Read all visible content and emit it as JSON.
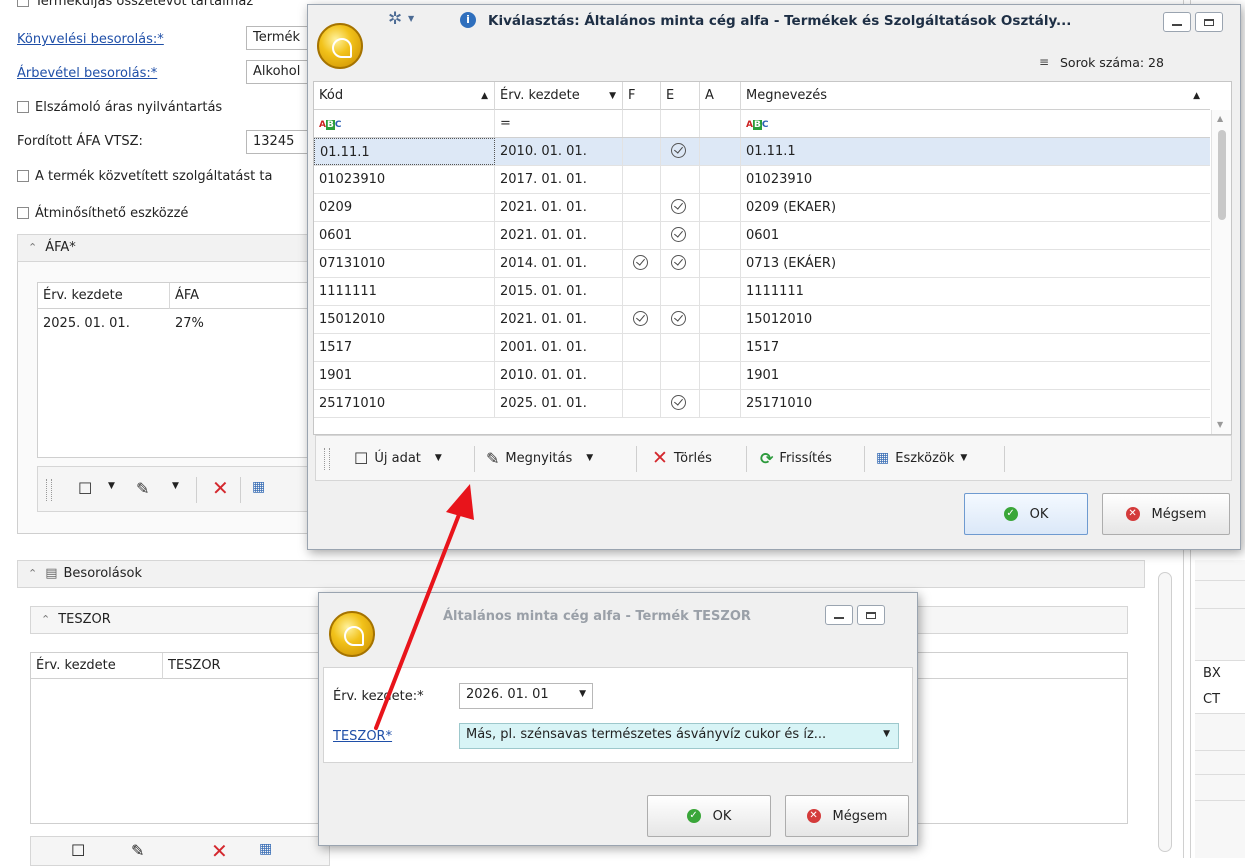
{
  "bg_form": {
    "top_checkbox": "Termékdíjas összetevőt tartalmaz",
    "konyv_label": "Könyvelési besorolás:*",
    "konyv_value": "Termék",
    "arbevetel_label": "Árbevétel besorolás:*",
    "arbevetel_value": "Alkohol",
    "elszamolo": "Elszámoló áras nyilvántartás",
    "forditott_label": "Fordított ÁFA VTSZ:",
    "forditott_value": "13245",
    "kozvetitett": "A termék közvetített szolgáltatást ta",
    "atminosit": "Átminősíthető eszközzé",
    "afa_group": "ÁFA*",
    "afa_cols": [
      "Érv. kezdete",
      "ÁFA"
    ],
    "afa_row": [
      "2025. 01. 01.",
      "27%"
    ],
    "besorolasok": "Besorolások",
    "teszor_group": "TESZOR",
    "teszor_cols": [
      "Érv. kezdete",
      "TESZOR"
    ],
    "right_cells": [
      "BX",
      "CT"
    ]
  },
  "kivalasztas": {
    "title": "Kiválasztás: Általános minta cég alfa - Termékek és Szolgáltatások Osztály...",
    "row_count": "Sorok száma: 28",
    "columns": [
      "Kód",
      "Érv. kezdete",
      "F",
      "E",
      "A",
      "Megnevezés"
    ],
    "filter_eq": "=",
    "rows": [
      {
        "kod": "01.11.1",
        "erv": "2010. 01. 01.",
        "f": false,
        "e": true,
        "nev": "01.11.1"
      },
      {
        "kod": "01023910",
        "erv": "2017. 01. 01.",
        "f": false,
        "e": false,
        "nev": "01023910"
      },
      {
        "kod": "0209",
        "erv": "2021. 01. 01.",
        "f": false,
        "e": true,
        "nev": "0209 (EKAER)"
      },
      {
        "kod": "0601",
        "erv": "2021. 01. 01.",
        "f": false,
        "e": true,
        "nev": "0601"
      },
      {
        "kod": "07131010",
        "erv": "2014. 01. 01.",
        "f": true,
        "e": true,
        "nev": "0713 (EKÁER)"
      },
      {
        "kod": "1111111",
        "erv": "2015. 01. 01.",
        "f": false,
        "e": false,
        "nev": "1111111"
      },
      {
        "kod": "15012010",
        "erv": "2021. 01. 01.",
        "f": true,
        "e": true,
        "nev": "15012010"
      },
      {
        "kod": "1517",
        "erv": "2001. 01. 01.",
        "f": false,
        "e": false,
        "nev": "1517"
      },
      {
        "kod": "1901",
        "erv": "2010. 01. 01.",
        "f": false,
        "e": false,
        "nev": "1901"
      },
      {
        "kod": "25171010",
        "erv": "2025. 01. 01.",
        "f": false,
        "e": true,
        "nev": "25171010"
      }
    ],
    "toolbar": {
      "uj": "Új adat",
      "megnyitas": "Megnyitás",
      "torles": "Törlés",
      "frissites": "Frissítés",
      "eszkozok": "Eszközök"
    },
    "ok": "OK",
    "cancel": "Mégsem"
  },
  "teszor_dialog": {
    "title": "Általános minta cég alfa - Termék TESZOR",
    "erv_label": "Érv. kezdete:*",
    "erv_value": "2026. 01. 01",
    "teszor_label": "TESZOR*",
    "teszor_value": "Más, pl. szénsavas természetes ásványvíz cukor és íz...",
    "ok": "OK",
    "cancel": "Mégsem"
  },
  "colors": {
    "accent": "#1f4fa8",
    "selected_row": "#dde8f6",
    "highlight_field": "#d8f4f6",
    "arrow": "#e8141b"
  }
}
